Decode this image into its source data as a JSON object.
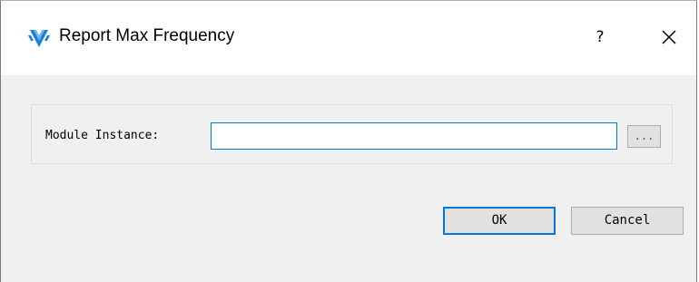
{
  "window": {
    "title": "Report Max Frequency",
    "help_glyph": "?",
    "close_icon": "close-icon",
    "app_icon": "gowin-logo-icon",
    "accent_color": "#0078d7"
  },
  "form": {
    "module_instance_label": "Module Instance:",
    "module_instance_value": "",
    "browse_label": "..."
  },
  "buttons": {
    "ok_label": "OK",
    "cancel_label": "Cancel"
  }
}
